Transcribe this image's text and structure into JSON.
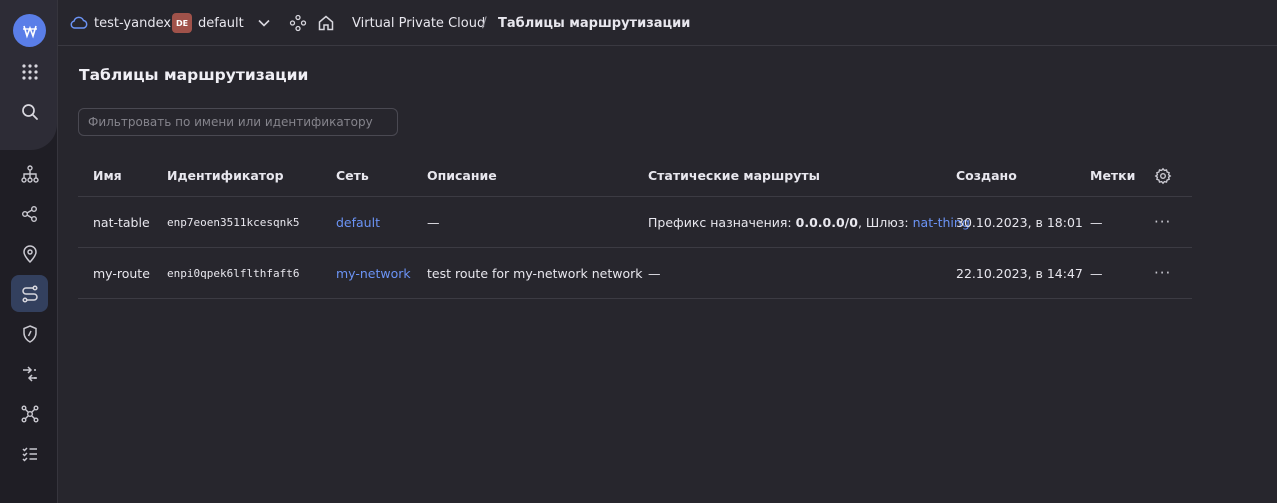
{
  "topbar": {
    "cloud": "test-yandex",
    "folder_badge": "DE",
    "folder": "default",
    "crumbs": [
      "Virtual Private Cloud",
      "Таблицы маршрутизации"
    ],
    "separator": "/"
  },
  "page": {
    "title": "Таблицы маршрутизации",
    "filter_placeholder": "Фильтровать по имени или идентификатору"
  },
  "table": {
    "headers": {
      "name": "Имя",
      "id": "Идентификатор",
      "network": "Сеть",
      "description": "Описание",
      "routes": "Статические маршруты",
      "created": "Создано",
      "labels": "Метки"
    },
    "rows": [
      {
        "name": "nat-table",
        "id": "enp7eoen3511kcesqnk5",
        "network": "default",
        "description": "—",
        "route_prefix_label": "Префикс назначения: ",
        "route_prefix": "0.0.0.0/0",
        "route_gateway_label": ", Шлюз: ",
        "route_gateway": "nat-thing",
        "created": "30.10.2023, в 18:01",
        "labels": "—",
        "actions": "···"
      },
      {
        "name": "my-route",
        "id": "enpi0qpek6lflthfaft6",
        "network": "my-network",
        "description": "test route for my-network network",
        "routes": "—",
        "created": "22.10.2023, в 14:47",
        "labels": "—",
        "actions": "···"
      }
    ]
  },
  "icons": {
    "logo": "yandex-cloud-logo",
    "rail": [
      "services-grid-icon",
      "search-icon",
      "network-icon",
      "subnets-icon",
      "location-icon",
      "route-tables-icon",
      "security-group-icon",
      "gateways-icon",
      "topology-icon",
      "checklist-icon"
    ]
  },
  "colors": {
    "accent": "#5a7ee8",
    "link": "#6b93f5",
    "folder_badge": "#a0524a",
    "active_rail": "#33405e"
  }
}
